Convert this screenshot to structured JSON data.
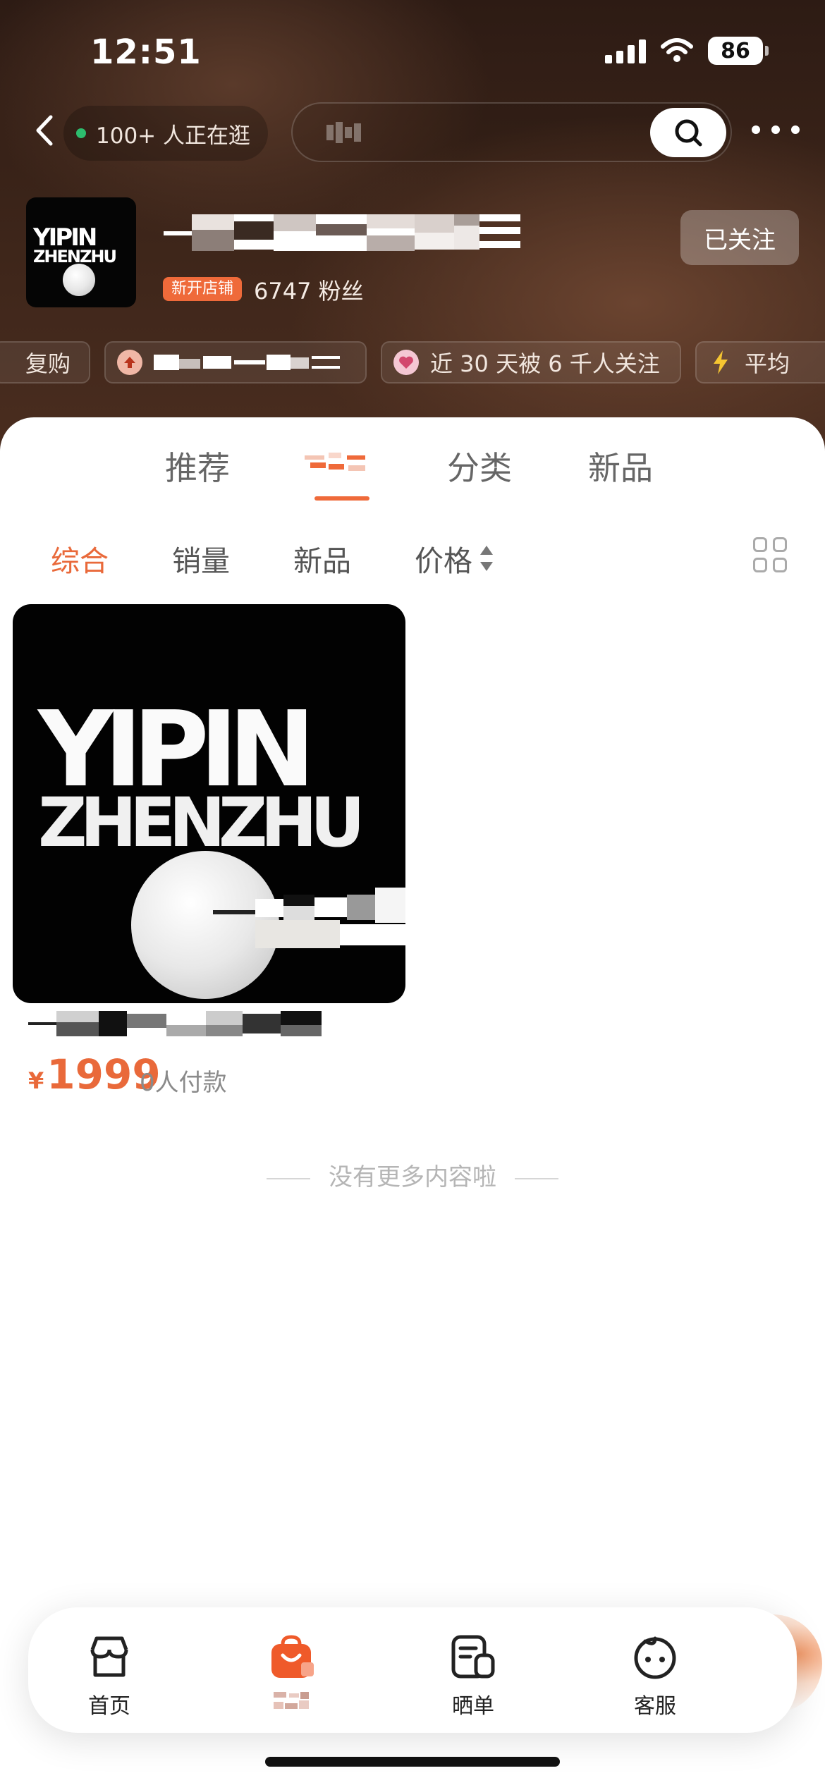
{
  "status_bar": {
    "time": "12:51",
    "battery": "86"
  },
  "nav": {
    "visitors": "100+ 人正在逛"
  },
  "shop": {
    "logo_line1": "YIPIN",
    "logo_line2": "ZHENZHU",
    "badge": "新开店铺",
    "fans": "6747 粉丝",
    "follow_label": "已关注"
  },
  "tags": [
    {
      "label": "复购",
      "icon": ""
    },
    {
      "label": "",
      "icon": "arrow-up-icon"
    },
    {
      "label": "近 30 天被 6 千人关注",
      "icon": "heart-icon"
    },
    {
      "label": "平均",
      "icon": "lightning-icon"
    }
  ],
  "tabs": [
    {
      "label": "推荐"
    },
    {
      "label": ""
    },
    {
      "label": "分类"
    },
    {
      "label": "新品"
    }
  ],
  "sort": [
    {
      "label": "综合"
    },
    {
      "label": "销量"
    },
    {
      "label": "新品"
    },
    {
      "label": "价格"
    }
  ],
  "product": {
    "image_line1": "YIPIN",
    "image_line2": "ZHENZHU",
    "currency": "¥",
    "price": "1999",
    "buyers": "0人付款"
  },
  "no_more": "没有更多内容啦",
  "bottom_nav": [
    {
      "label": "首页",
      "icon": "shop-home-icon"
    },
    {
      "label": "",
      "icon": "shopping-bag-icon"
    },
    {
      "label": "晒单",
      "icon": "review-note-icon"
    },
    {
      "label": "客服",
      "icon": "customer-service-icon"
    }
  ],
  "colors": {
    "accent": "#e9693a",
    "header_bg": "#3b2419",
    "badge_bg": "#ef6a3a"
  }
}
